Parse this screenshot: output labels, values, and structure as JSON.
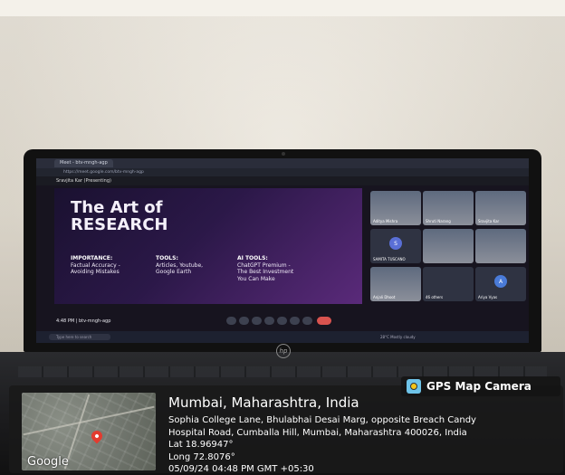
{
  "browser": {
    "tab_title": "Meet - btv-mngh-agp",
    "url": "https://meet.google.com/btv-mngh-agp",
    "presenting_label": "Sravjita Kar (Presenting)"
  },
  "slide": {
    "title_line1": "The Art of",
    "title_line2": "RESEARCH",
    "columns": [
      {
        "heading": "IMPORTANCE:",
        "lines": [
          "Factual Accuracy -",
          "Avoiding Mistakes"
        ]
      },
      {
        "heading": "TOOLS:",
        "lines": [
          "Articles, Youtube,",
          "Google Earth"
        ]
      },
      {
        "heading": "AI TOOLS:",
        "lines": [
          "ChatGPT Premium -",
          "The Best Investment",
          "You Can Make"
        ]
      }
    ]
  },
  "participants": [
    {
      "name": "Aditya Mishra",
      "kind": "video"
    },
    {
      "name": "Shruti Narang",
      "kind": "video"
    },
    {
      "name": "Sravjita Kar",
      "kind": "video"
    },
    {
      "name": "SAMITA TUSCANO",
      "kind": "avatar",
      "initial": "S",
      "color": "#5a6fd6"
    },
    {
      "name": "",
      "kind": "video"
    },
    {
      "name": "",
      "kind": "video"
    },
    {
      "name": "Anjali Dhoot",
      "kind": "video"
    },
    {
      "name": "46 others",
      "kind": "others"
    },
    {
      "name": "Ariya Vyas",
      "kind": "avatar",
      "initial": "A",
      "color": "#4a7bd8"
    }
  ],
  "meeting": {
    "time_code": "4:48 PM  |  btv-mngh-agp"
  },
  "taskbar": {
    "search_placeholder": "Type here to search",
    "weather": "28°C Mostly cloudy"
  },
  "gps": {
    "badge_label": "GPS Map Camera",
    "map_brand": "Google",
    "city": "Mumbai, Maharashtra, India",
    "address_line1": "Sophia College Lane, Bhulabhai Desai Marg, opposite Breach Candy",
    "address_line2": "Hospital Road, Cumballa Hill, Mumbai, Maharashtra 400026, India",
    "lat": "Lat 18.96947°",
    "long": "Long 72.8076°",
    "datetime": "05/09/24 04:48 PM GMT +05:30"
  },
  "colors": {
    "slide_bg": "#2b1848",
    "pin": "#e33b2f",
    "gps_icon": "#6ec3e8"
  }
}
